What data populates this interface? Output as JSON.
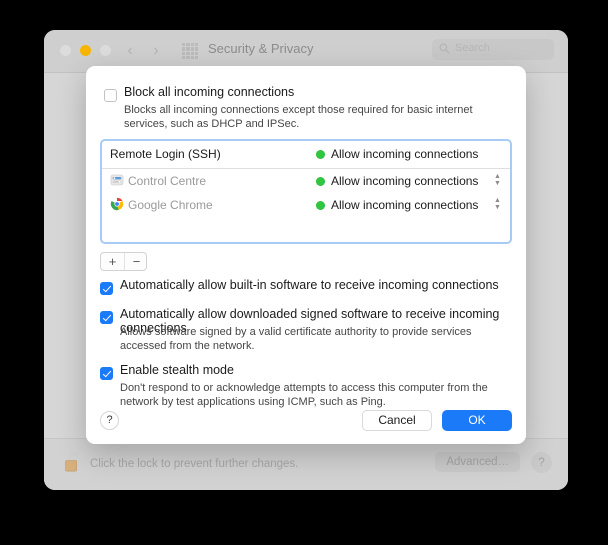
{
  "window": {
    "title": "Security & Privacy",
    "traffic_lights": [
      "close",
      "minimize",
      "zoom"
    ],
    "nav_back_icon": "chevron-left-icon",
    "nav_forward_icon": "chevron-right-icon",
    "grid_icon": "grid-view-icon",
    "search": {
      "placeholder": "Search",
      "icon": "search-icon"
    }
  },
  "lock_bar": {
    "icon": "unlocked-padlock-icon",
    "text": "Click the lock to prevent further changes.",
    "advanced_label": "Advanced…",
    "help_label": "?"
  },
  "sheet": {
    "block_all": {
      "label": "Block all incoming connections",
      "checked": false,
      "description": "Blocks all incoming connections except those required for basic internet services, such as DHCP and IPSec."
    },
    "apps_list": {
      "rows": [
        {
          "name": "Remote Login (SSH)",
          "icon": null,
          "status": "Allow incoming connections",
          "status_color": "#2fc641",
          "has_stepper": false,
          "muted": false
        },
        {
          "name": "Control Centre",
          "icon": "control-centre-icon",
          "status": "Allow incoming connections",
          "status_color": "#2fc641",
          "has_stepper": true,
          "muted": true
        },
        {
          "name": "Google Chrome",
          "icon": "google-chrome-icon",
          "status": "Allow incoming connections",
          "status_color": "#2fc641",
          "has_stepper": true,
          "muted": true
        }
      ]
    },
    "list_controls": {
      "add_label": "+",
      "remove_label": "−"
    },
    "options": [
      {
        "label": "Automatically allow built-in software to receive incoming connections",
        "checked": true,
        "description": null
      },
      {
        "label": "Automatically allow downloaded signed software to receive incoming connections",
        "checked": true,
        "description": "Allows software signed by a valid certificate authority to provide services accessed from the network."
      },
      {
        "label": "Enable stealth mode",
        "checked": true,
        "description": "Don't respond to or acknowledge attempts to access this computer from the network by test applications using ICMP, such as Ping."
      }
    ],
    "footer": {
      "help_label": "?",
      "cancel_label": "Cancel",
      "ok_label": "OK"
    }
  },
  "colors": {
    "accent": "#1a7af8",
    "status_green": "#2fc641",
    "focus_ring": "#a8cbf5",
    "window_chrome": "#d4d4d4"
  }
}
